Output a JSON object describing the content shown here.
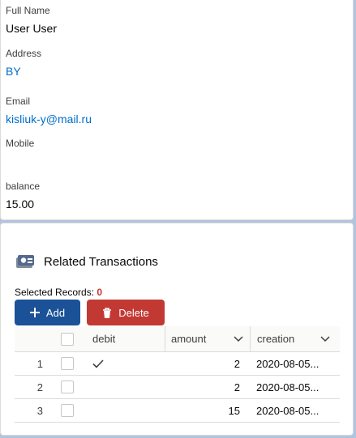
{
  "record": {
    "full_name_label": "Full Name",
    "full_name_value": "User User",
    "address_label": "Address",
    "address_value": "BY",
    "email_label": "Email",
    "email_value": "kisliuk-y@mail.ru",
    "mobile_label": "Mobile",
    "mobile_value": "",
    "balance_label": "balance",
    "balance_value": "15.00"
  },
  "related": {
    "title": "Related Transactions",
    "icon": "transactions-icon",
    "selected_label": "Selected Records:",
    "selected_count": "0",
    "add_label": "Add",
    "delete_label": "Delete",
    "columns": [
      "debit",
      "amount",
      "creation"
    ],
    "rows": [
      {
        "num": "1",
        "debit": true,
        "amount": "2",
        "creation": "2020-08-05..."
      },
      {
        "num": "2",
        "debit": false,
        "amount": "2",
        "creation": "2020-08-05..."
      },
      {
        "num": "3",
        "debit": false,
        "amount": "15",
        "creation": "2020-08-05..."
      }
    ]
  },
  "colors": {
    "add_button": "#1b5297",
    "delete_button": "#c23934",
    "link": "#006dcc",
    "background": "#b0c4df"
  }
}
